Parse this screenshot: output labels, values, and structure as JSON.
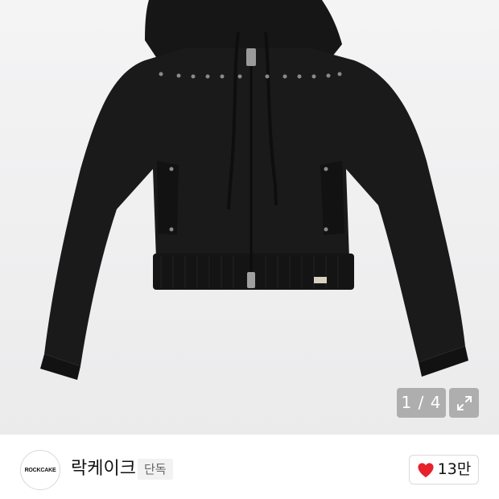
{
  "gallery": {
    "current_page": "1",
    "separator": "/",
    "total_pages": "4",
    "counter_label": "1 / 4",
    "expand_icon": "expand-arrows-icon",
    "product_image": "black-knit-zip-up-hoodie"
  },
  "brand": {
    "logo_text": "ROCKCAKE",
    "name": "락케이크",
    "badge": "단독"
  },
  "like": {
    "icon": "heart-icon",
    "count": "13만",
    "color": "#e8202a"
  },
  "colors": {
    "background": "#efeff0",
    "overlay": "#969696",
    "text": "#111111"
  }
}
